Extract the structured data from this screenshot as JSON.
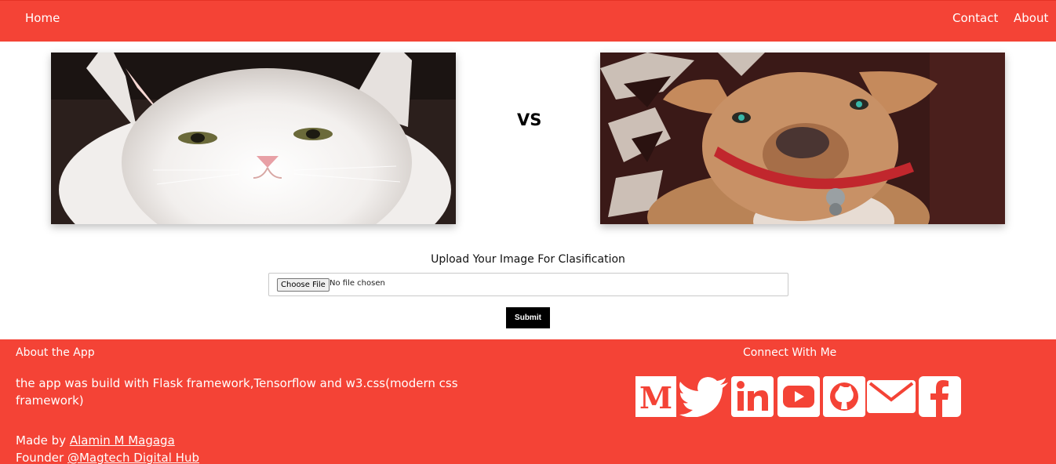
{
  "nav": {
    "home": "Home",
    "contact": "Contact",
    "about": "About"
  },
  "hero": {
    "vs": "VS",
    "left_image": "cat-photo",
    "right_image": "dog-photo"
  },
  "upload": {
    "label": "Upload Your Image For Clasification",
    "choose_button": "Choose File",
    "file_status": "No file chosen",
    "submit": "Submit"
  },
  "footer": {
    "about_title": "About the App",
    "about_text": "the app was build with Flask framework,Tensorflow and w3.css(modern css framework)",
    "made_by_prefix": "Made by ",
    "author": "Alamin M Magaga",
    "founder_prefix": "Founder ",
    "company": "@Magtech Digital Hub",
    "connect_title": "Connect With Me",
    "social_icons": [
      "medium-icon",
      "twitter-icon",
      "linkedin-icon",
      "youtube-icon",
      "github-icon",
      "email-icon",
      "facebook-icon"
    ]
  },
  "colors": {
    "brand": "#f44336",
    "white": "#ffffff",
    "black": "#000000"
  }
}
